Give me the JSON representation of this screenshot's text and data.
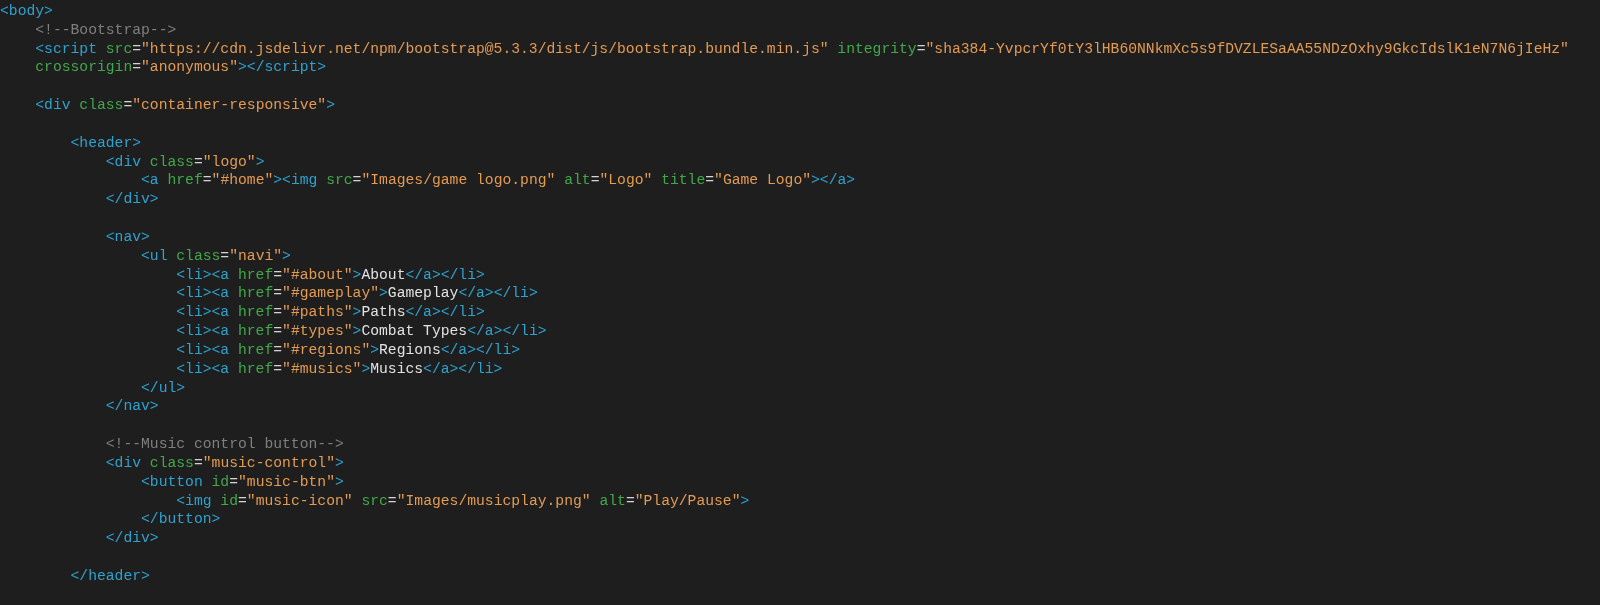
{
  "editor": {
    "lines": [
      {
        "kind": "code",
        "tokens": [
          {
            "kind": "tag",
            "text": "<body>"
          }
        ],
        "children": [
          {
            "kind": "code",
            "tokens": [
              {
                "kind": "comment",
                "text": "<!--Bootstrap-->"
              }
            ]
          },
          {
            "kind": "code",
            "tokens": [
              {
                "kind": "tag",
                "text": "<script"
              },
              {
                "kind": "attr",
                "text": " src"
              },
              {
                "kind": "punct",
                "text": "="
              },
              {
                "kind": "string",
                "text": "\"https://cdn.jsdelivr.net/npm/bootstrap@5.3.3/dist/js/bootstrap.bundle.min.js\""
              },
              {
                "kind": "attr",
                "text": " integrity"
              },
              {
                "kind": "punct",
                "text": "="
              },
              {
                "kind": "string",
                "text": "\"sha384-YvpcrYf0tY3lHB60NNkmXc5s9fDVZLESaAA55NDzOxhy9GkcIdslK1eN7N6jIeHz\""
              }
            ]
          },
          {
            "kind": "code",
            "tokens": [
              {
                "kind": "attr",
                "text": "crossorigin"
              },
              {
                "kind": "punct",
                "text": "="
              },
              {
                "kind": "string",
                "text": "\"anonymous\""
              },
              {
                "kind": "tag",
                "text": "></script>"
              }
            ]
          },
          {
            "kind": "blank"
          },
          {
            "kind": "code",
            "tokens": [
              {
                "kind": "tag",
                "text": "<div"
              },
              {
                "kind": "attr",
                "text": " class"
              },
              {
                "kind": "punct",
                "text": "="
              },
              {
                "kind": "string",
                "text": "\"container-responsive\""
              },
              {
                "kind": "tag",
                "text": ">"
              }
            ],
            "children": [
              {
                "kind": "blank"
              },
              {
                "kind": "code",
                "tokens": [
                  {
                    "kind": "tag",
                    "text": "<header>"
                  }
                ],
                "children": [
                  {
                    "kind": "code",
                    "tokens": [
                      {
                        "kind": "tag",
                        "text": "<div"
                      },
                      {
                        "kind": "attr",
                        "text": " class"
                      },
                      {
                        "kind": "punct",
                        "text": "="
                      },
                      {
                        "kind": "string",
                        "text": "\"logo\""
                      },
                      {
                        "kind": "tag",
                        "text": ">"
                      }
                    ],
                    "children": [
                      {
                        "kind": "code",
                        "tokens": [
                          {
                            "kind": "tag",
                            "text": "<a"
                          },
                          {
                            "kind": "attr",
                            "text": " href"
                          },
                          {
                            "kind": "punct",
                            "text": "="
                          },
                          {
                            "kind": "string",
                            "text": "\"#home\""
                          },
                          {
                            "kind": "tag",
                            "text": "><img"
                          },
                          {
                            "kind": "attr",
                            "text": " src"
                          },
                          {
                            "kind": "punct",
                            "text": "="
                          },
                          {
                            "kind": "string",
                            "text": "\"Images/game logo.png\""
                          },
                          {
                            "kind": "attr",
                            "text": " alt"
                          },
                          {
                            "kind": "punct",
                            "text": "="
                          },
                          {
                            "kind": "string",
                            "text": "\"Logo\""
                          },
                          {
                            "kind": "attr",
                            "text": " title"
                          },
                          {
                            "kind": "punct",
                            "text": "="
                          },
                          {
                            "kind": "string",
                            "text": "\"Game Logo\""
                          },
                          {
                            "kind": "tag",
                            "text": "></a>"
                          }
                        ]
                      }
                    ]
                  },
                  {
                    "kind": "code",
                    "tokens": [
                      {
                        "kind": "tag",
                        "text": "</div>"
                      }
                    ]
                  },
                  {
                    "kind": "blank"
                  },
                  {
                    "kind": "code",
                    "tokens": [
                      {
                        "kind": "tag",
                        "text": "<nav>"
                      }
                    ],
                    "children": [
                      {
                        "kind": "code",
                        "tokens": [
                          {
                            "kind": "tag",
                            "text": "<ul"
                          },
                          {
                            "kind": "attr",
                            "text": " class"
                          },
                          {
                            "kind": "punct",
                            "text": "="
                          },
                          {
                            "kind": "string",
                            "text": "\"navi\""
                          },
                          {
                            "kind": "tag",
                            "text": ">"
                          }
                        ],
                        "children": [
                          {
                            "kind": "code",
                            "tokens": [
                              {
                                "kind": "tag",
                                "text": "<li><a"
                              },
                              {
                                "kind": "attr",
                                "text": " href"
                              },
                              {
                                "kind": "punct",
                                "text": "="
                              },
                              {
                                "kind": "string",
                                "text": "\"#about\""
                              },
                              {
                                "kind": "tag",
                                "text": ">"
                              },
                              {
                                "kind": "text",
                                "text": "About"
                              },
                              {
                                "kind": "tag",
                                "text": "</a></li>"
                              }
                            ]
                          },
                          {
                            "kind": "code",
                            "tokens": [
                              {
                                "kind": "tag",
                                "text": "<li><a"
                              },
                              {
                                "kind": "attr",
                                "text": " href"
                              },
                              {
                                "kind": "punct",
                                "text": "="
                              },
                              {
                                "kind": "string",
                                "text": "\"#gameplay\""
                              },
                              {
                                "kind": "tag",
                                "text": ">"
                              },
                              {
                                "kind": "text",
                                "text": "Gameplay"
                              },
                              {
                                "kind": "tag",
                                "text": "</a></li>"
                              }
                            ]
                          },
                          {
                            "kind": "code",
                            "tokens": [
                              {
                                "kind": "tag",
                                "text": "<li><a"
                              },
                              {
                                "kind": "attr",
                                "text": " href"
                              },
                              {
                                "kind": "punct",
                                "text": "="
                              },
                              {
                                "kind": "string",
                                "text": "\"#paths\""
                              },
                              {
                                "kind": "tag",
                                "text": ">"
                              },
                              {
                                "kind": "text",
                                "text": "Paths"
                              },
                              {
                                "kind": "tag",
                                "text": "</a></li>"
                              }
                            ]
                          },
                          {
                            "kind": "code",
                            "tokens": [
                              {
                                "kind": "tag",
                                "text": "<li><a"
                              },
                              {
                                "kind": "attr",
                                "text": " href"
                              },
                              {
                                "kind": "punct",
                                "text": "="
                              },
                              {
                                "kind": "string",
                                "text": "\"#types\""
                              },
                              {
                                "kind": "tag",
                                "text": ">"
                              },
                              {
                                "kind": "text",
                                "text": "Combat Types"
                              },
                              {
                                "kind": "tag",
                                "text": "</a></li>"
                              }
                            ]
                          },
                          {
                            "kind": "code",
                            "tokens": [
                              {
                                "kind": "tag",
                                "text": "<li><a"
                              },
                              {
                                "kind": "attr",
                                "text": " href"
                              },
                              {
                                "kind": "punct",
                                "text": "="
                              },
                              {
                                "kind": "string",
                                "text": "\"#regions\""
                              },
                              {
                                "kind": "tag",
                                "text": ">"
                              },
                              {
                                "kind": "text",
                                "text": "Regions"
                              },
                              {
                                "kind": "tag",
                                "text": "</a></li>"
                              }
                            ]
                          },
                          {
                            "kind": "code",
                            "tokens": [
                              {
                                "kind": "tag",
                                "text": "<li><a"
                              },
                              {
                                "kind": "attr",
                                "text": " href"
                              },
                              {
                                "kind": "punct",
                                "text": "="
                              },
                              {
                                "kind": "string",
                                "text": "\"#musics\""
                              },
                              {
                                "kind": "tag",
                                "text": ">"
                              },
                              {
                                "kind": "text",
                                "text": "Musics"
                              },
                              {
                                "kind": "tag",
                                "text": "</a></li>"
                              }
                            ]
                          }
                        ]
                      },
                      {
                        "kind": "code",
                        "tokens": [
                          {
                            "kind": "tag",
                            "text": "</ul>"
                          }
                        ]
                      }
                    ]
                  },
                  {
                    "kind": "code",
                    "tokens": [
                      {
                        "kind": "tag",
                        "text": "</nav>"
                      }
                    ]
                  },
                  {
                    "kind": "blank"
                  },
                  {
                    "kind": "code",
                    "tokens": [
                      {
                        "kind": "comment",
                        "text": "<!--Music control button-->"
                      }
                    ]
                  },
                  {
                    "kind": "code",
                    "tokens": [
                      {
                        "kind": "tag",
                        "text": "<div"
                      },
                      {
                        "kind": "attr",
                        "text": " class"
                      },
                      {
                        "kind": "punct",
                        "text": "="
                      },
                      {
                        "kind": "string",
                        "text": "\"music-control\""
                      },
                      {
                        "kind": "tag",
                        "text": ">"
                      }
                    ],
                    "children": [
                      {
                        "kind": "code",
                        "tokens": [
                          {
                            "kind": "tag",
                            "text": "<button"
                          },
                          {
                            "kind": "attr",
                            "text": " id"
                          },
                          {
                            "kind": "punct",
                            "text": "="
                          },
                          {
                            "kind": "string",
                            "text": "\"music-btn\""
                          },
                          {
                            "kind": "tag",
                            "text": ">"
                          }
                        ],
                        "children": [
                          {
                            "kind": "code",
                            "tokens": [
                              {
                                "kind": "tag",
                                "text": "<img"
                              },
                              {
                                "kind": "attr",
                                "text": " id"
                              },
                              {
                                "kind": "punct",
                                "text": "="
                              },
                              {
                                "kind": "string",
                                "text": "\"music-icon\""
                              },
                              {
                                "kind": "attr",
                                "text": " src"
                              },
                              {
                                "kind": "punct",
                                "text": "="
                              },
                              {
                                "kind": "string",
                                "text": "\"Images/musicplay.png\""
                              },
                              {
                                "kind": "attr",
                                "text": " alt"
                              },
                              {
                                "kind": "punct",
                                "text": "="
                              },
                              {
                                "kind": "string",
                                "text": "\"Play/Pause\""
                              },
                              {
                                "kind": "tag",
                                "text": ">"
                              }
                            ]
                          }
                        ]
                      },
                      {
                        "kind": "code",
                        "tokens": [
                          {
                            "kind": "tag",
                            "text": "</button>"
                          }
                        ]
                      }
                    ]
                  },
                  {
                    "kind": "code",
                    "tokens": [
                      {
                        "kind": "tag",
                        "text": "</div>"
                      }
                    ]
                  },
                  {
                    "kind": "blank"
                  }
                ]
              },
              {
                "kind": "code",
                "tokens": [
                  {
                    "kind": "tag",
                    "text": "</header>"
                  }
                ]
              }
            ]
          }
        ]
      }
    ]
  }
}
